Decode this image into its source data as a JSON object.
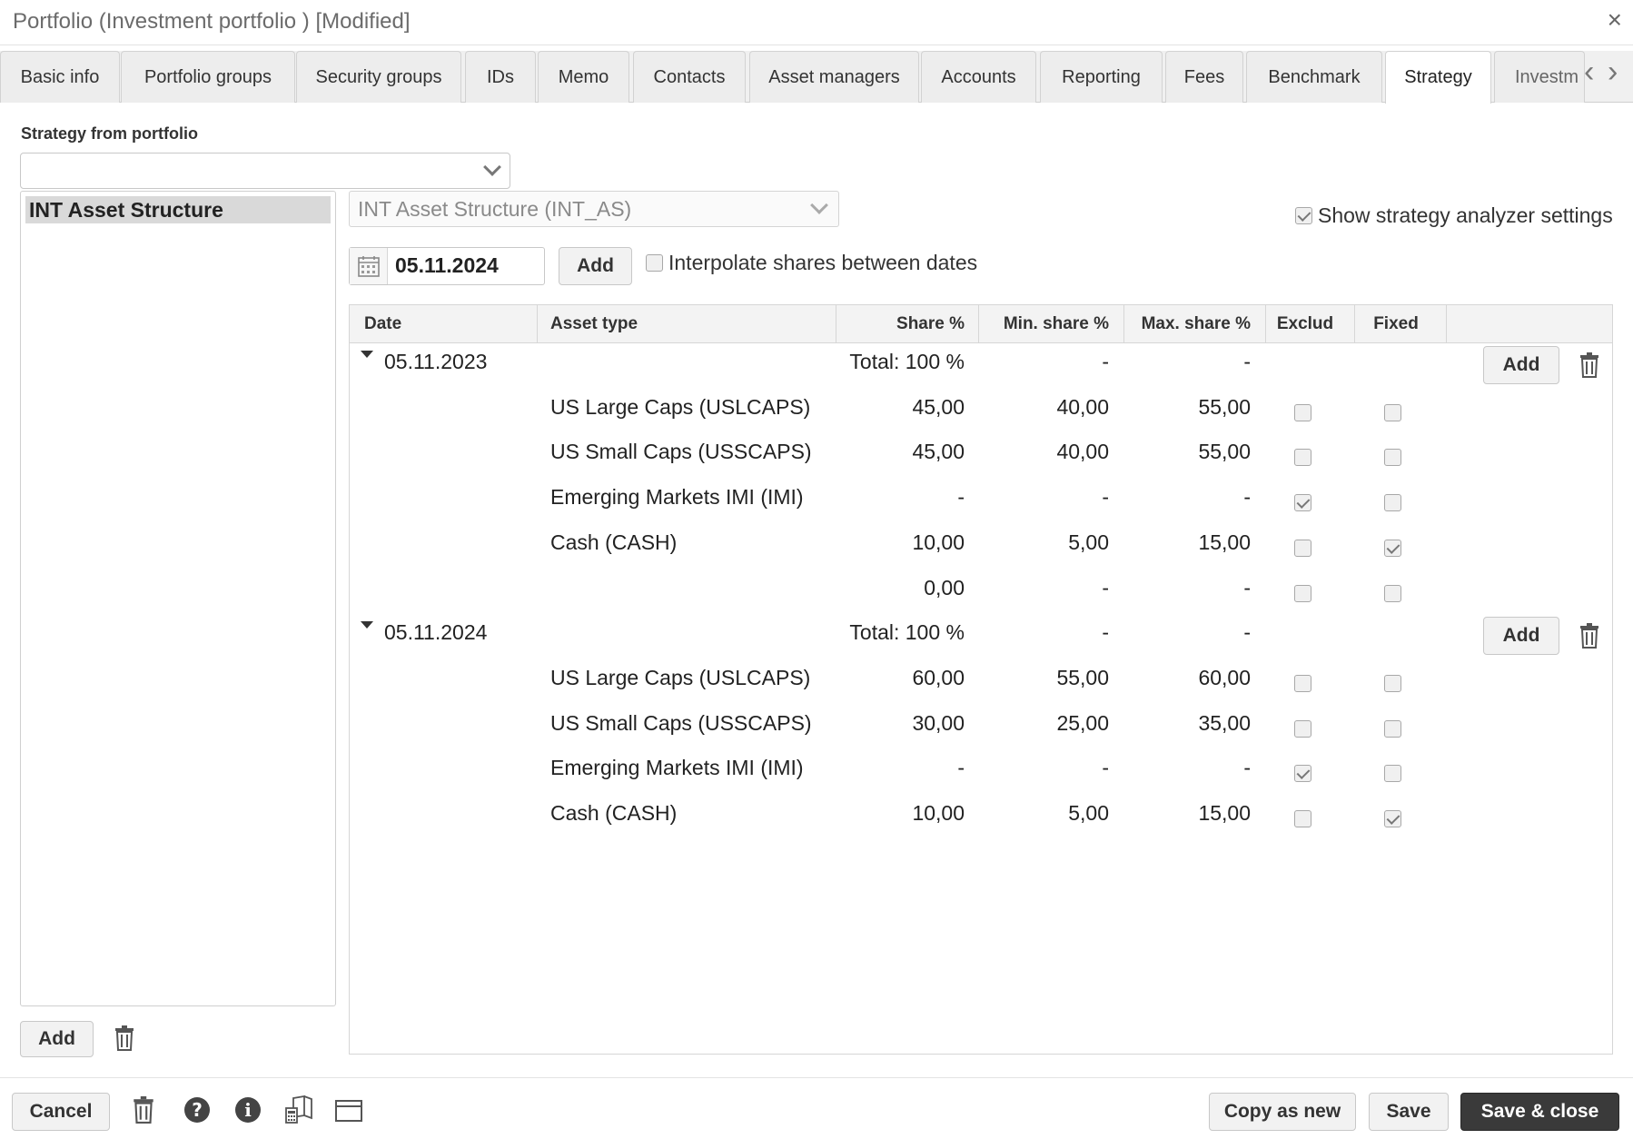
{
  "window": {
    "title": "Portfolio (Investment portfolio ) [Modified]",
    "close_label": "×"
  },
  "tabs": [
    {
      "label": "Basic info",
      "active": false
    },
    {
      "label": "Portfolio groups",
      "active": false
    },
    {
      "label": "Security groups",
      "active": false
    },
    {
      "label": "IDs",
      "active": false
    },
    {
      "label": "Memo",
      "active": false
    },
    {
      "label": "Contacts",
      "active": false
    },
    {
      "label": "Asset managers",
      "active": false
    },
    {
      "label": "Accounts",
      "active": false
    },
    {
      "label": "Reporting",
      "active": false
    },
    {
      "label": "Fees",
      "active": false
    },
    {
      "label": "Benchmark",
      "active": false
    },
    {
      "label": "Strategy",
      "active": true
    },
    {
      "label": "Investm",
      "active": false
    }
  ],
  "tab_nav": {
    "left": "‹",
    "right": "›"
  },
  "left_panel": {
    "strategy_from_portfolio_label": "Strategy from portfolio",
    "strategy_from_portfolio_value": "",
    "strategy_list": [
      "INT Asset Structure"
    ],
    "add_label": "Add"
  },
  "right_panel": {
    "structure_select_value": "INT Asset Structure (INT_AS)",
    "show_settings_label": "Show strategy analyzer settings",
    "show_settings_checked": true,
    "date_value": "05.11.2024",
    "add_date_label": "Add",
    "interpolate_label": "Interpolate shares between dates",
    "interpolate_checked": false
  },
  "table": {
    "columns": [
      "Date",
      "Asset type",
      "Share %",
      "Min. share %",
      "Max. share %",
      "Exclud",
      "Fixed"
    ],
    "groups": [
      {
        "date": "05.11.2023",
        "total": "Total: 100 %",
        "min": "-",
        "max": "-",
        "add_label": "Add",
        "rows": [
          {
            "asset": "US Large Caps (USLCAPS)",
            "share": "45,00",
            "min": "40,00",
            "max": "55,00",
            "exclud": false,
            "fixed": false
          },
          {
            "asset": "US Small Caps (USSCAPS)",
            "share": "45,00",
            "min": "40,00",
            "max": "55,00",
            "exclud": false,
            "fixed": false
          },
          {
            "asset": "Emerging Markets IMI (IMI)",
            "share": "-",
            "min": "-",
            "max": "-",
            "exclud": true,
            "fixed": false
          },
          {
            "asset": "Cash (CASH)",
            "share": "10,00",
            "min": "5,00",
            "max": "15,00",
            "exclud": false,
            "fixed": true
          },
          {
            "asset": "",
            "share": "0,00",
            "min": "-",
            "max": "-",
            "exclud": false,
            "fixed": false
          }
        ]
      },
      {
        "date": "05.11.2024",
        "total": "Total: 100 %",
        "min": "-",
        "max": "-",
        "add_label": "Add",
        "rows": [
          {
            "asset": "US Large Caps (USLCAPS)",
            "share": "60,00",
            "min": "55,00",
            "max": "60,00",
            "exclud": false,
            "fixed": false
          },
          {
            "asset": "US Small Caps (USSCAPS)",
            "share": "30,00",
            "min": "25,00",
            "max": "35,00",
            "exclud": false,
            "fixed": false
          },
          {
            "asset": "Emerging Markets IMI (IMI)",
            "share": "-",
            "min": "-",
            "max": "-",
            "exclud": true,
            "fixed": false
          },
          {
            "asset": "Cash (CASH)",
            "share": "10,00",
            "min": "5,00",
            "max": "15,00",
            "exclud": false,
            "fixed": true
          }
        ]
      }
    ]
  },
  "footer": {
    "cancel_label": "Cancel",
    "copy_as_new_label": "Copy as new",
    "save_label": "Save",
    "save_close_label": "Save & close",
    "icons": [
      "trash-icon",
      "help-icon",
      "info-icon",
      "calculator-book-icon",
      "window-icon"
    ]
  }
}
